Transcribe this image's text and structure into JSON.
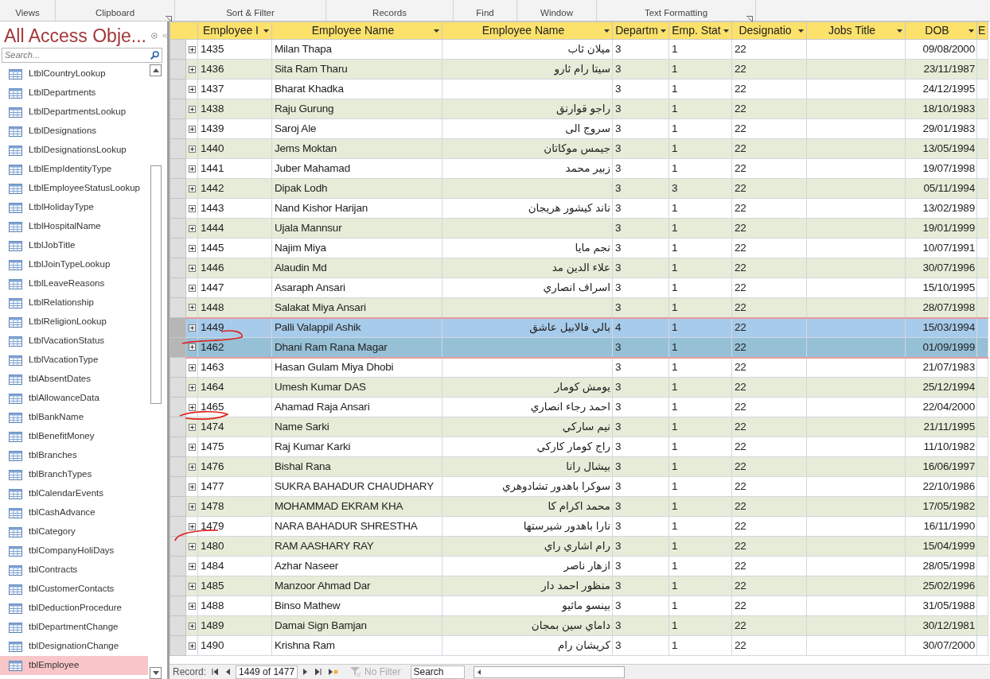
{
  "ribbon_groups": [
    "Views",
    "Clipboard",
    "Sort & Filter",
    "Records",
    "Find",
    "Window",
    "Text Formatting"
  ],
  "navigation": {
    "title": "All Access Obje...",
    "search": {
      "placeholder": "Search..."
    },
    "items": [
      {
        "label": "LtblCountryLookup",
        "selected": false
      },
      {
        "label": "LtblDepartments",
        "selected": false
      },
      {
        "label": "LtblDepartmentsLookup",
        "selected": false
      },
      {
        "label": "LtblDesignations",
        "selected": false
      },
      {
        "label": "LtblDesignationsLookup",
        "selected": false
      },
      {
        "label": "LtblEmpIdentityType",
        "selected": false
      },
      {
        "label": "LtblEmployeeStatusLookup",
        "selected": false
      },
      {
        "label": "LtblHolidayType",
        "selected": false
      },
      {
        "label": "LtblHospitalName",
        "selected": false
      },
      {
        "label": "LtblJobTitle",
        "selected": false
      },
      {
        "label": "LtblJoinTypeLookup",
        "selected": false
      },
      {
        "label": "LtblLeaveReasons",
        "selected": false
      },
      {
        "label": "LtblRelationship",
        "selected": false
      },
      {
        "label": "LtblReligionLookup",
        "selected": false
      },
      {
        "label": "LtblVacationStatus",
        "selected": false
      },
      {
        "label": "LtblVacationType",
        "selected": false
      },
      {
        "label": "tblAbsentDates",
        "selected": false
      },
      {
        "label": "tblAllowanceData",
        "selected": false
      },
      {
        "label": "tblBankName",
        "selected": false
      },
      {
        "label": "tblBenefitMoney",
        "selected": false
      },
      {
        "label": "tblBranches",
        "selected": false
      },
      {
        "label": "tblBranchTypes",
        "selected": false
      },
      {
        "label": "tblCalendarEvents",
        "selected": false
      },
      {
        "label": "tblCashAdvance",
        "selected": false
      },
      {
        "label": "tblCategory",
        "selected": false
      },
      {
        "label": "tblCompanyHoliDays",
        "selected": false
      },
      {
        "label": "tblContracts",
        "selected": false
      },
      {
        "label": "tblCustomerContacts",
        "selected": false
      },
      {
        "label": "tblDeductionProcedure",
        "selected": false
      },
      {
        "label": "tblDepartmentChange",
        "selected": false
      },
      {
        "label": "tblDesignationChange",
        "selected": false
      },
      {
        "label": "tblEmployee",
        "selected": true
      }
    ]
  },
  "table": {
    "columns": [
      "Employee I",
      "Employee Name",
      "Employee Name",
      "Departm",
      "Emp. Stat",
      "Designatio",
      "Jobs Title",
      "DOB",
      "E"
    ],
    "rows": [
      {
        "cells": [
          "1435",
          "Milan Thapa",
          "ميلان ثاب",
          "3",
          "1",
          "22",
          "",
          "09/08/2000"
        ],
        "selected": false,
        "current": false
      },
      {
        "cells": [
          "1436",
          "Sita Ram Tharu",
          "سيتا رام ثارو",
          "3",
          "1",
          "22",
          "",
          "23/11/1987"
        ],
        "selected": false,
        "current": false
      },
      {
        "cells": [
          "1437",
          "Bharat Khadka",
          "",
          "3",
          "1",
          "22",
          "",
          "24/12/1995"
        ],
        "selected": false,
        "current": false
      },
      {
        "cells": [
          "1438",
          "Raju Gurung",
          "راجو قوارنق",
          "3",
          "1",
          "22",
          "",
          "18/10/1983"
        ],
        "selected": false,
        "current": false
      },
      {
        "cells": [
          "1439",
          "Saroj Ale",
          "سروج الى",
          "3",
          "1",
          "22",
          "",
          "29/01/1983"
        ],
        "selected": false,
        "current": false
      },
      {
        "cells": [
          "1440",
          "Jems Moktan",
          "جيمس موكاتان",
          "3",
          "1",
          "22",
          "",
          "13/05/1994"
        ],
        "selected": false,
        "current": false
      },
      {
        "cells": [
          "1441",
          "Juber Mahamad",
          "زبير محمد",
          "3",
          "1",
          "22",
          "",
          "19/07/1998"
        ],
        "selected": false,
        "current": false
      },
      {
        "cells": [
          "1442",
          "Dipak Lodh",
          "",
          "3",
          "3",
          "22",
          "",
          "05/11/1994"
        ],
        "selected": false,
        "current": false
      },
      {
        "cells": [
          "1443",
          "Nand Kishor Harijan",
          "ناند كيشور هريجان",
          "3",
          "1",
          "22",
          "",
          "13/02/1989"
        ],
        "selected": false,
        "current": false
      },
      {
        "cells": [
          "1444",
          "Ujala Mannsur",
          "",
          "3",
          "1",
          "22",
          "",
          "19/01/1999"
        ],
        "selected": false,
        "current": false
      },
      {
        "cells": [
          "1445",
          "Najim Miya",
          "نجم مايا",
          "3",
          "1",
          "22",
          "",
          "10/07/1991"
        ],
        "selected": false,
        "current": false
      },
      {
        "cells": [
          "1446",
          "Alaudin Md",
          "علاء الدين مد",
          "3",
          "1",
          "22",
          "",
          "30/07/1996"
        ],
        "selected": false,
        "current": false
      },
      {
        "cells": [
          "1447",
          "Asaraph Ansari",
          "اسراف انصاري",
          "3",
          "1",
          "22",
          "",
          "15/10/1995"
        ],
        "selected": false,
        "current": false
      },
      {
        "cells": [
          "1448",
          "Salakat Miya Ansari",
          "",
          "3",
          "1",
          "22",
          "",
          "28/07/1998"
        ],
        "selected": false,
        "current": false
      },
      {
        "cells": [
          "1449",
          "Palli Valappil Ashik",
          "بالي فالابيل عاشق",
          "4",
          "1",
          "22",
          "",
          "15/03/1994"
        ],
        "selected": true,
        "current": false
      },
      {
        "cells": [
          "1462",
          "Dhani Ram Rana Magar",
          "",
          "3",
          "1",
          "22",
          "",
          "01/09/1999"
        ],
        "selected": true,
        "current": true
      },
      {
        "cells": [
          "1463",
          "Hasan Gulam Miya Dhobi",
          "",
          "3",
          "1",
          "22",
          "",
          "21/07/1983"
        ],
        "selected": false,
        "current": false
      },
      {
        "cells": [
          "1464",
          "Umesh Kumar DAS",
          "يومش كومار",
          "3",
          "1",
          "22",
          "",
          "25/12/1994"
        ],
        "selected": false,
        "current": false
      },
      {
        "cells": [
          "1465",
          "Ahamad Raja Ansari",
          "احمد رجاء انصاري",
          "3",
          "1",
          "22",
          "",
          "22/04/2000"
        ],
        "selected": false,
        "current": false
      },
      {
        "cells": [
          "1474",
          "Name Sarki",
          "نيم ساركي",
          "3",
          "1",
          "22",
          "",
          "21/11/1995"
        ],
        "selected": false,
        "current": false
      },
      {
        "cells": [
          "1475",
          "Raj Kumar Karki",
          "راج كومار كاركي",
          "3",
          "1",
          "22",
          "",
          "11/10/1982"
        ],
        "selected": false,
        "current": false
      },
      {
        "cells": [
          "1476",
          "Bishal Rana",
          "بيشال رانا",
          "3",
          "1",
          "22",
          "",
          "16/06/1997"
        ],
        "selected": false,
        "current": false
      },
      {
        "cells": [
          "1477",
          "SUKRA BAHADUR CHAUDHARY",
          "سوكرا باهدور تشادوهري",
          "3",
          "1",
          "22",
          "",
          "22/10/1986"
        ],
        "selected": false,
        "current": false
      },
      {
        "cells": [
          "1478",
          "MOHAMMAD EKRAM KHA",
          "محمد اكرام كا",
          "3",
          "1",
          "22",
          "",
          "17/05/1982"
        ],
        "selected": false,
        "current": false
      },
      {
        "cells": [
          "1479",
          "NARA BAHADUR SHRESTHA",
          "نارا باهدور شيرستها",
          "3",
          "1",
          "22",
          "",
          "16/11/1990"
        ],
        "selected": false,
        "current": false
      },
      {
        "cells": [
          "1480",
          "RAM AASHARY RAY",
          "رام اشاري راي",
          "3",
          "1",
          "22",
          "",
          "15/04/1999"
        ],
        "selected": false,
        "current": false
      },
      {
        "cells": [
          "1484",
          "Azhar Naseer",
          "ازهار ناصر",
          "3",
          "1",
          "22",
          "",
          "28/05/1998"
        ],
        "selected": false,
        "current": false
      },
      {
        "cells": [
          "1485",
          "Manzoor Ahmad Dar",
          "منظور احمد دار",
          "3",
          "1",
          "22",
          "",
          "25/02/1996"
        ],
        "selected": false,
        "current": false
      },
      {
        "cells": [
          "1488",
          "Binso Mathew",
          "بينسو ماثيو",
          "3",
          "1",
          "22",
          "",
          "31/05/1988"
        ],
        "selected": false,
        "current": false
      },
      {
        "cells": [
          "1489",
          "Damai Sign Bamjan",
          "داماي سين بمجان",
          "3",
          "1",
          "22",
          "",
          "30/12/1981"
        ],
        "selected": false,
        "current": false
      },
      {
        "cells": [
          "1490",
          "Krishna Ram",
          "كريشان رام",
          "3",
          "1",
          "22",
          "",
          "30/07/2000"
        ],
        "selected": false,
        "current": false
      }
    ]
  },
  "record_bar": {
    "label": "Record:",
    "position": "1449 of 1477",
    "filter": {
      "label": "No Filter",
      "disabled": true
    },
    "search": {
      "value": "Search"
    }
  }
}
